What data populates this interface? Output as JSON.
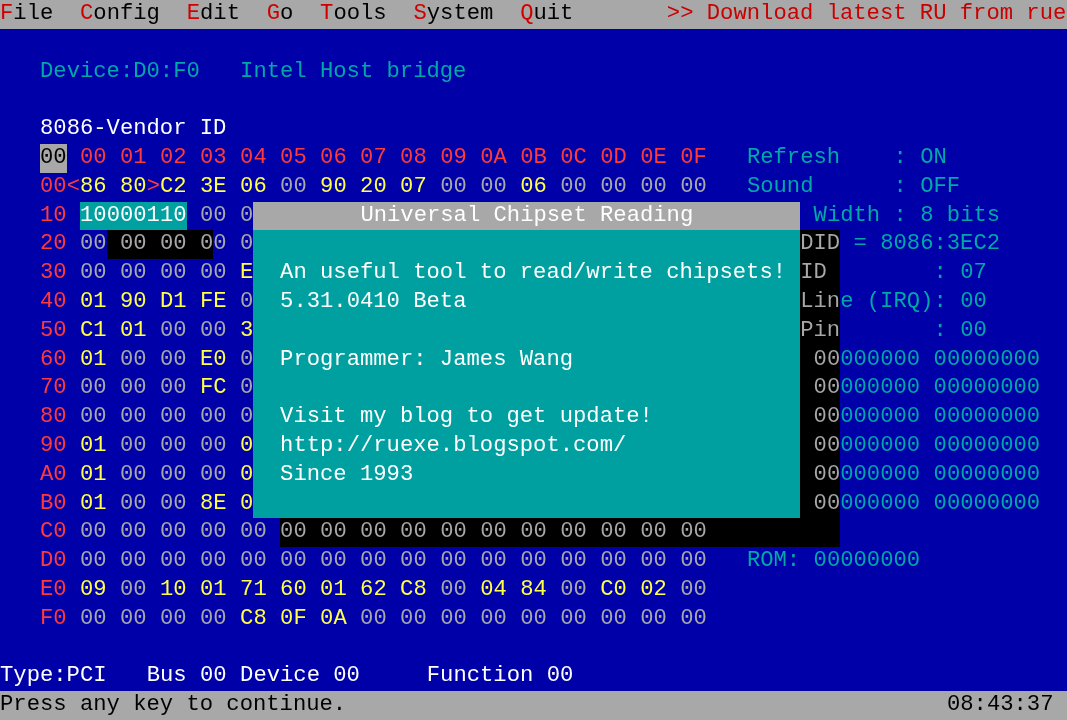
{
  "menu": {
    "items": [
      "File",
      "Config",
      "Edit",
      "Go",
      "Tools",
      "System",
      "Quit"
    ],
    "notice": ">> Download latest RU from rue"
  },
  "device": {
    "address": "Device:D0:F0",
    "name": "Intel Host bridge"
  },
  "register_title": "8086-Vendor ID",
  "hex": {
    "corner": "00",
    "columns": [
      "00",
      "01",
      "02",
      "03",
      "04",
      "05",
      "06",
      "07",
      "08",
      "09",
      "0A",
      "0B",
      "0C",
      "0D",
      "0E",
      "0F"
    ],
    "rows": [
      {
        "label": "00",
        "bracket": [
          "<",
          ">"
        ],
        "bytes": [
          "86",
          "80",
          "C2",
          "3E",
          "06",
          "00",
          "90",
          "20",
          "07",
          "00",
          "00",
          "06",
          "00",
          "00",
          "00",
          "00"
        ],
        "lit": [
          true,
          true,
          true,
          true,
          true,
          false,
          true,
          true,
          true,
          false,
          false,
          true,
          false,
          false,
          false,
          false
        ]
      },
      {
        "label": "10",
        "editor": "10000110",
        "bytes": [
          "00",
          "0"
        ],
        "lit": [
          false,
          false
        ]
      },
      {
        "label": "20",
        "band": true,
        "bytes": [
          "00",
          "00",
          "00",
          "00",
          "0"
        ],
        "lit": [
          false,
          false,
          false,
          false,
          false
        ]
      },
      {
        "label": "30",
        "bytes": [
          "00",
          "00",
          "00",
          "00",
          "E"
        ],
        "lit": [
          false,
          false,
          false,
          false,
          true
        ]
      },
      {
        "label": "40",
        "bytes": [
          "01",
          "90",
          "D1",
          "FE",
          "0"
        ],
        "lit": [
          true,
          true,
          true,
          true,
          false
        ]
      },
      {
        "label": "50",
        "bytes": [
          "C1",
          "01",
          "00",
          "00",
          "3"
        ],
        "lit": [
          true,
          true,
          false,
          false,
          true
        ]
      },
      {
        "label": "60",
        "bytes": [
          "01",
          "00",
          "00",
          "E0",
          "0"
        ],
        "lit": [
          true,
          false,
          false,
          true,
          false
        ]
      },
      {
        "label": "70",
        "bytes": [
          "00",
          "00",
          "00",
          "FC",
          "0"
        ],
        "lit": [
          false,
          false,
          false,
          true,
          false
        ]
      },
      {
        "label": "80",
        "bytes": [
          "00",
          "00",
          "00",
          "00",
          "0"
        ],
        "lit": [
          false,
          false,
          false,
          false,
          false
        ]
      },
      {
        "label": "90",
        "bytes": [
          "01",
          "00",
          "00",
          "00",
          "0"
        ],
        "lit": [
          true,
          false,
          false,
          false,
          true
        ]
      },
      {
        "label": "A0",
        "bytes": [
          "01",
          "00",
          "00",
          "00",
          "0"
        ],
        "lit": [
          true,
          false,
          false,
          false,
          true
        ]
      },
      {
        "label": "B0",
        "bytes": [
          "01",
          "00",
          "00",
          "8E",
          "0"
        ],
        "lit": [
          true,
          false,
          false,
          true,
          true
        ]
      },
      {
        "label": "C0",
        "bytes": [
          "00",
          "00",
          "00",
          "00",
          "00",
          "00",
          "00",
          "00",
          "00",
          "00",
          "00",
          "00",
          "00",
          "00",
          "00",
          "00"
        ],
        "lit": [
          false,
          false,
          false,
          false,
          false
        ]
      },
      {
        "label": "D0",
        "bytes": [
          "00",
          "00",
          "00",
          "00",
          "00",
          "00",
          "00",
          "00",
          "00",
          "00",
          "00",
          "00",
          "00",
          "00",
          "00",
          "00"
        ],
        "lit": [
          false,
          false,
          false,
          false,
          false,
          false,
          false,
          false,
          false,
          false,
          false,
          false,
          false,
          false,
          false,
          false
        ]
      },
      {
        "label": "E0",
        "bytes": [
          "09",
          "00",
          "10",
          "01",
          "71",
          "60",
          "01",
          "62",
          "C8",
          "00",
          "04",
          "84",
          "00",
          "C0",
          "02",
          "00"
        ],
        "lit": [
          true,
          false,
          true,
          true,
          true,
          true,
          true,
          true,
          true,
          false,
          true,
          true,
          false,
          true,
          true,
          false
        ]
      },
      {
        "label": "F0",
        "bytes": [
          "00",
          "00",
          "00",
          "00",
          "C8",
          "0F",
          "0A",
          "00",
          "00",
          "00",
          "00",
          "00",
          "00",
          "00",
          "00",
          "00"
        ],
        "lit": [
          false,
          false,
          false,
          false,
          true,
          true,
          true,
          false,
          false,
          false,
          false,
          false,
          false,
          false,
          false,
          false
        ]
      }
    ]
  },
  "info": [
    {
      "label": "Refresh",
      "value": ": ON"
    },
    {
      "label": "Sound",
      "value": ": OFF"
    },
    {
      "label": "Width",
      "value": ": 8 bits"
    },
    {
      "label": "DID",
      "value": "= 8086:3EC2"
    },
    {
      "label": "ID",
      "value": ": 07"
    },
    {
      "label": "Line (IRQ)",
      "value": ": 00"
    },
    {
      "label": "Pin",
      "value": ": 00"
    }
  ],
  "bit_rows": [
    [
      "00000000",
      "00000000"
    ],
    [
      "00000000",
      "00000000"
    ],
    [
      "00000000",
      "00000000"
    ],
    [
      "00000000",
      "00000000"
    ],
    [
      "00000000",
      "00000000"
    ],
    [
      "00000000",
      "00000000"
    ]
  ],
  "rom": {
    "label": "ROM:",
    "value": "00000000"
  },
  "status": {
    "type": "Type:PCI",
    "bus": "Bus 00",
    "device": "Device 00",
    "function": "Function 00"
  },
  "footer": {
    "message": "Press any key to continue.",
    "time": "08:43:37"
  },
  "dialog": {
    "title": "Universal Chipset Reading",
    "paragraphs": [
      [
        "An useful tool to read/write chipsets!",
        "5.31.0410 Beta"
      ],
      [
        "Programmer: James Wang"
      ],
      [
        "Visit my blog to get update!",
        "http://ruexe.blogspot.com/",
        "Since 1993"
      ]
    ]
  }
}
